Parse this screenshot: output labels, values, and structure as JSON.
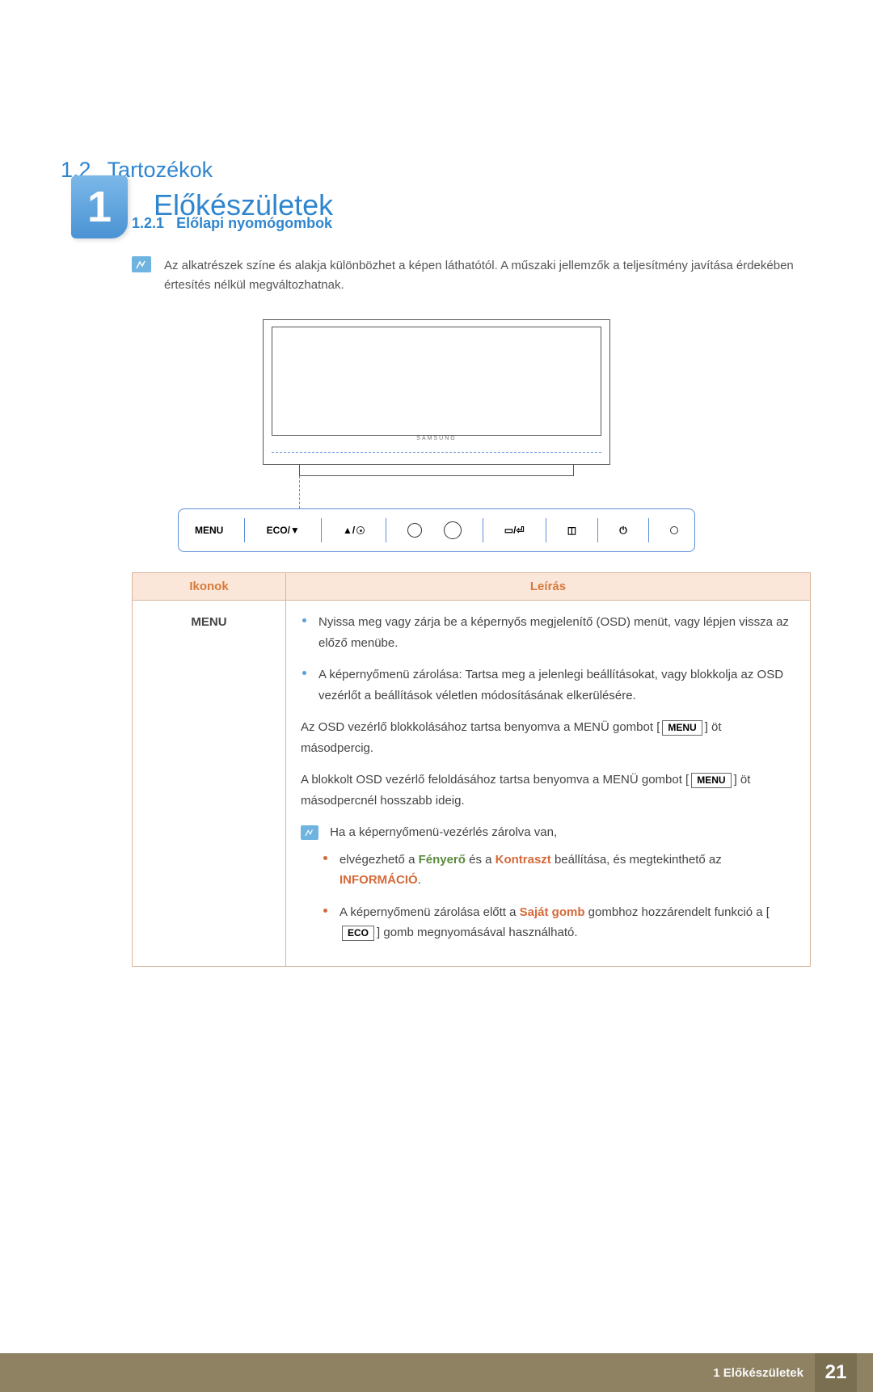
{
  "chapter": {
    "number": "1",
    "title": "Előkészületek"
  },
  "section": {
    "number": "1.2",
    "title": "Tartozékok"
  },
  "subsection": {
    "number": "1.2.1",
    "title": "Előlapi nyomógombok"
  },
  "top_note": "Az alkatrészek színe és alakja különbözhet a képen láthatótól. A műszaki jellemzők a teljesítmény javítása érdekében értesítés nélkül megváltozhatnak.",
  "panel": {
    "menu": "MENU",
    "eco": "ECO/▼",
    "brand": "SAMSUNG"
  },
  "table": {
    "header_icons": "Ikonok",
    "header_desc": "Leírás",
    "row_icon_label": "MENU",
    "bullet1": "Nyissa meg vagy zárja be a képernyős megjelenítő (OSD) menüt, vagy lépjen vissza az előző menübe.",
    "bullet2": "A képernyőmenü zárolása: Tartsa meg a jelenlegi beállításokat, vagy blokkolja az OSD vezérlőt a beállítások véletlen módosításának elkerülésére.",
    "para1_a": "Az OSD vezérlő blokkolásához tartsa benyomva a MENÜ gombot [",
    "para1_btn": "MENU",
    "para1_b": "] öt másodpercig.",
    "para2_a": "A blokkolt OSD vezérlő feloldásához tartsa benyomva a MENÜ gombot [",
    "para2_btn": "MENU",
    "para2_b": "] öt másodpercnél hosszabb ideig.",
    "note_intro": "Ha a képernyőmenü-vezérlés zárolva van,",
    "sub1_a": "elvégezhető a ",
    "sub1_kw1": "Fényerő",
    "sub1_b": " és a ",
    "sub1_kw2": "Kontraszt",
    "sub1_c": " beállítása, és megtekinthető az ",
    "sub1_kw3": "INFORMÁCIÓ",
    "sub1_d": ".",
    "sub2_a": "A képernyőmenü zárolása előtt a ",
    "sub2_kw1": "Saját gomb",
    "sub2_b": " gombhoz hozzárendelt funkció a [",
    "sub2_btn": "ECO",
    "sub2_c": "] gomb megnyomásával használható."
  },
  "footer": {
    "label": "1 Előkészületek",
    "page": "21"
  }
}
